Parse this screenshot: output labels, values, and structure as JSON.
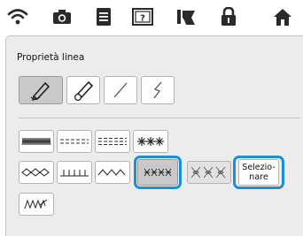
{
  "toolbar": {
    "icons": [
      "wifi-icon",
      "camera-icon",
      "document-icon",
      "help-icon",
      "threading-icon",
      "lock-icon",
      "home-icon"
    ]
  },
  "dialog": {
    "title": "Proprietà linea",
    "tool_buttons": [
      "pencil-sewing-tool",
      "pencil-plus-tool",
      "straight-line-tool",
      "freehand-line-tool"
    ],
    "stitch_buttons": {
      "row1": [
        "zigzag-stitch",
        "dashed-stitch",
        "double-dashed-stitch",
        "star-stitch"
      ],
      "row2": [
        "chain-stitch",
        "blanket-stitch",
        "wave-stitch",
        "cross-stitch-small",
        "cross-stitch-large"
      ],
      "row3": [
        "handwritten-stitch"
      ]
    },
    "select_button": {
      "line1": "Selezio-",
      "line2": "nare"
    }
  },
  "colors": {
    "highlight": "#1a8fd9",
    "panel_bg": "#ececec"
  }
}
